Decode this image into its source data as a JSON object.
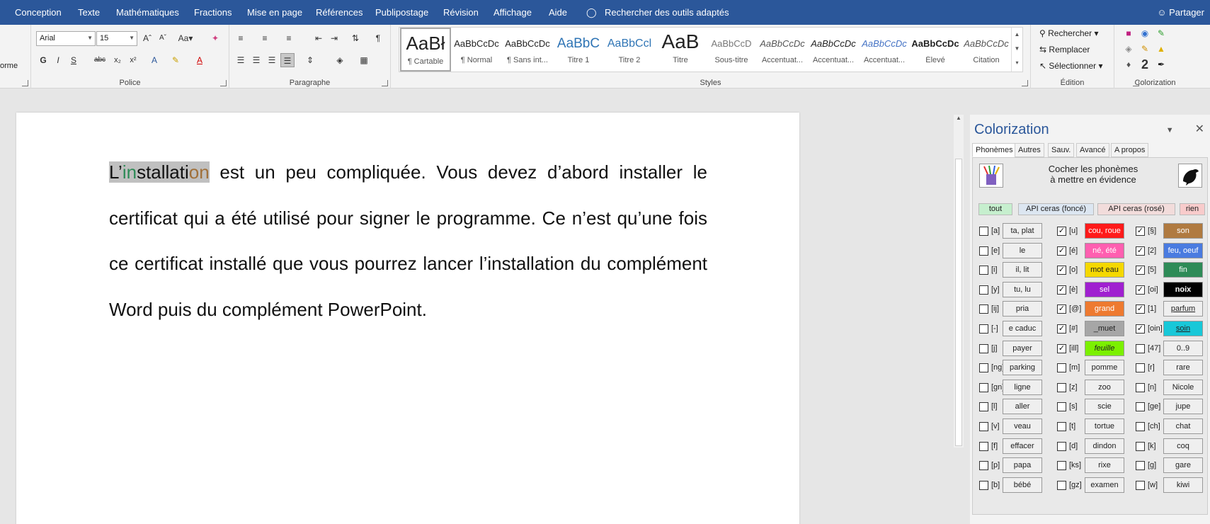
{
  "menubar": {
    "items": [
      "Conception",
      "Texte",
      "Mathématiques",
      "Fractions",
      "Mise en page",
      "Références",
      "Publipostage",
      "Révision",
      "Affichage",
      "Aide"
    ],
    "search": "Rechercher des outils adaptés",
    "share": "Partager"
  },
  "ribbon": {
    "left_fragment": "orme",
    "police": {
      "label": "Police",
      "font": "Arial",
      "size": "15"
    },
    "paragraphe": {
      "label": "Paragraphe"
    },
    "styles": {
      "label": "Styles",
      "items": [
        {
          "preview": "AaBł",
          "name": "¶ Cartable"
        },
        {
          "preview": "AaBbCcDc",
          "name": "¶ Normal"
        },
        {
          "preview": "AaBbCcDc",
          "name": "¶ Sans int..."
        },
        {
          "preview": "AaBbC",
          "name": "Titre 1"
        },
        {
          "preview": "AaBbCcl",
          "name": "Titre 2"
        },
        {
          "preview": "AaB",
          "name": "Titre"
        },
        {
          "preview": "AaBbCcD",
          "name": "Sous-titre"
        },
        {
          "preview": "AaBbCcDc",
          "name": "Accentuat..."
        },
        {
          "preview": "AaBbCcDc",
          "name": "Accentuat..."
        },
        {
          "preview": "AaBbCcDc",
          "name": "Accentuat..."
        },
        {
          "preview": "AaBbCcDc",
          "name": "Élevé"
        },
        {
          "preview": "AaBbCcDc",
          "name": "Citation"
        }
      ]
    },
    "edition": {
      "label": "Édition",
      "find": "Rechercher",
      "replace": "Remplacer",
      "select": "Sélectionner"
    },
    "colorization": {
      "label": "Colorization"
    }
  },
  "document": {
    "hl_prefix": "L’",
    "hl_green": "in",
    "hl_mid": "stallati",
    "hl_brown": "on",
    "rest": " est un peu compliquée. Vous devez d’abord installer le certificat qui a été utilisé pour signer le programme. Ce n’est qu’une fois ce certificat installé que vous pourrez lancer l’installation du complément Word puis du complément PowerPoint."
  },
  "pane": {
    "title": "Colorization",
    "tabs": [
      "Phonèmes",
      "Autres",
      "Sauv.",
      "Avancé",
      "A propos"
    ],
    "header_line1": "Cocher les phonèmes",
    "header_line2": "à mettre en évidence",
    "quick": [
      "tout",
      "API ceras (foncé)",
      "API ceras (rosé)",
      "rien"
    ],
    "quick_colors": [
      "#c6efce",
      "#dce6f1",
      "#f2dcdb",
      "#f8cbcb"
    ],
    "col1": [
      {
        "ph": "[a]",
        "ex": "ta, plat",
        "on": false
      },
      {
        "ph": "[e]",
        "ex": "le",
        "on": false
      },
      {
        "ph": "[i]",
        "ex": "il, lit",
        "on": false
      },
      {
        "ph": "[y]",
        "ex": "tu, lu",
        "on": false
      },
      {
        "ph": "[ij]",
        "ex": "pria",
        "on": false
      },
      {
        "ph": "[-]",
        "ex": "e caduc",
        "on": false
      },
      {
        "ph": "[j]",
        "ex": "payer",
        "on": false
      },
      {
        "ph": "[ng]",
        "ex": "parking",
        "on": false
      },
      {
        "ph": "[gn]",
        "ex": "ligne",
        "on": false
      },
      {
        "ph": "[l]",
        "ex": "aller",
        "on": false
      },
      {
        "ph": "[v]",
        "ex": "veau",
        "on": false
      },
      {
        "ph": "[f]",
        "ex": "effacer",
        "on": false
      },
      {
        "ph": "[p]",
        "ex": "papa",
        "on": false
      },
      {
        "ph": "[b]",
        "ex": "bébé",
        "on": false
      }
    ],
    "col2": [
      {
        "ph": "[u]",
        "ex": "cou, roue",
        "on": true,
        "bg": "#ff1a1a",
        "fg": "#ffffff"
      },
      {
        "ph": "[é]",
        "ex": "né, été",
        "on": true,
        "bg": "#ff5fb0",
        "fg": "#ffffff"
      },
      {
        "ph": "[o]",
        "ex": "mot eau",
        "on": true,
        "bg": "#f5d800",
        "fg": "#222222"
      },
      {
        "ph": "[è]",
        "ex": "sel",
        "on": true,
        "bg": "#a020d0",
        "fg": "#ffffff"
      },
      {
        "ph": "[@]",
        "ex": "grand",
        "on": true,
        "bg": "#ee7a30",
        "fg": "#ffffff"
      },
      {
        "ph": "[#]",
        "ex": "_muet",
        "on": true,
        "bg": "#a6a6a6",
        "fg": "#222222"
      },
      {
        "ph": "[ill]",
        "ex": "feuille",
        "on": true,
        "bg": "#7bf000",
        "fg": "#222222"
      },
      {
        "ph": "[m]",
        "ex": "pomme",
        "on": false
      },
      {
        "ph": "[z]",
        "ex": "zoo",
        "on": false
      },
      {
        "ph": "[s]",
        "ex": "scie",
        "on": false
      },
      {
        "ph": "[t]",
        "ex": "tortue",
        "on": false
      },
      {
        "ph": "[d]",
        "ex": "dindon",
        "on": false
      },
      {
        "ph": "[ks]",
        "ex": "rixe",
        "on": false
      },
      {
        "ph": "[gz]",
        "ex": "examen",
        "on": false
      }
    ],
    "col3": [
      {
        "ph": "[§]",
        "ex": "son",
        "on": true,
        "bg": "#b07a40",
        "fg": "#ffffff"
      },
      {
        "ph": "[2]",
        "ex": "feu, oeuf",
        "on": true,
        "bg": "#4a7be0",
        "fg": "#ffffff"
      },
      {
        "ph": "[5]",
        "ex": "fin",
        "on": true,
        "bg": "#2e8b57",
        "fg": "#ffffff"
      },
      {
        "ph": "[oi]",
        "ex": "noix",
        "on": true,
        "bg": "#000000",
        "fg": "#ffffff"
      },
      {
        "ph": "[1]",
        "ex": "parfum",
        "on": true
      },
      {
        "ph": "[oin]",
        "ex": "soin",
        "on": true,
        "bg": "#18c8d8",
        "fg": "#222222"
      },
      {
        "ph": "[47]",
        "ex": "0..9",
        "on": false
      },
      {
        "ph": "[r]",
        "ex": "rare",
        "on": false
      },
      {
        "ph": "[n]",
        "ex": "Nicole",
        "on": false
      },
      {
        "ph": "[ge]",
        "ex": "jupe",
        "on": false
      },
      {
        "ph": "[ch]",
        "ex": "chat",
        "on": false
      },
      {
        "ph": "[k]",
        "ex": "coq",
        "on": false
      },
      {
        "ph": "[g]",
        "ex": "gare",
        "on": false
      },
      {
        "ph": "[w]",
        "ex": "kiwi",
        "on": false
      }
    ]
  }
}
